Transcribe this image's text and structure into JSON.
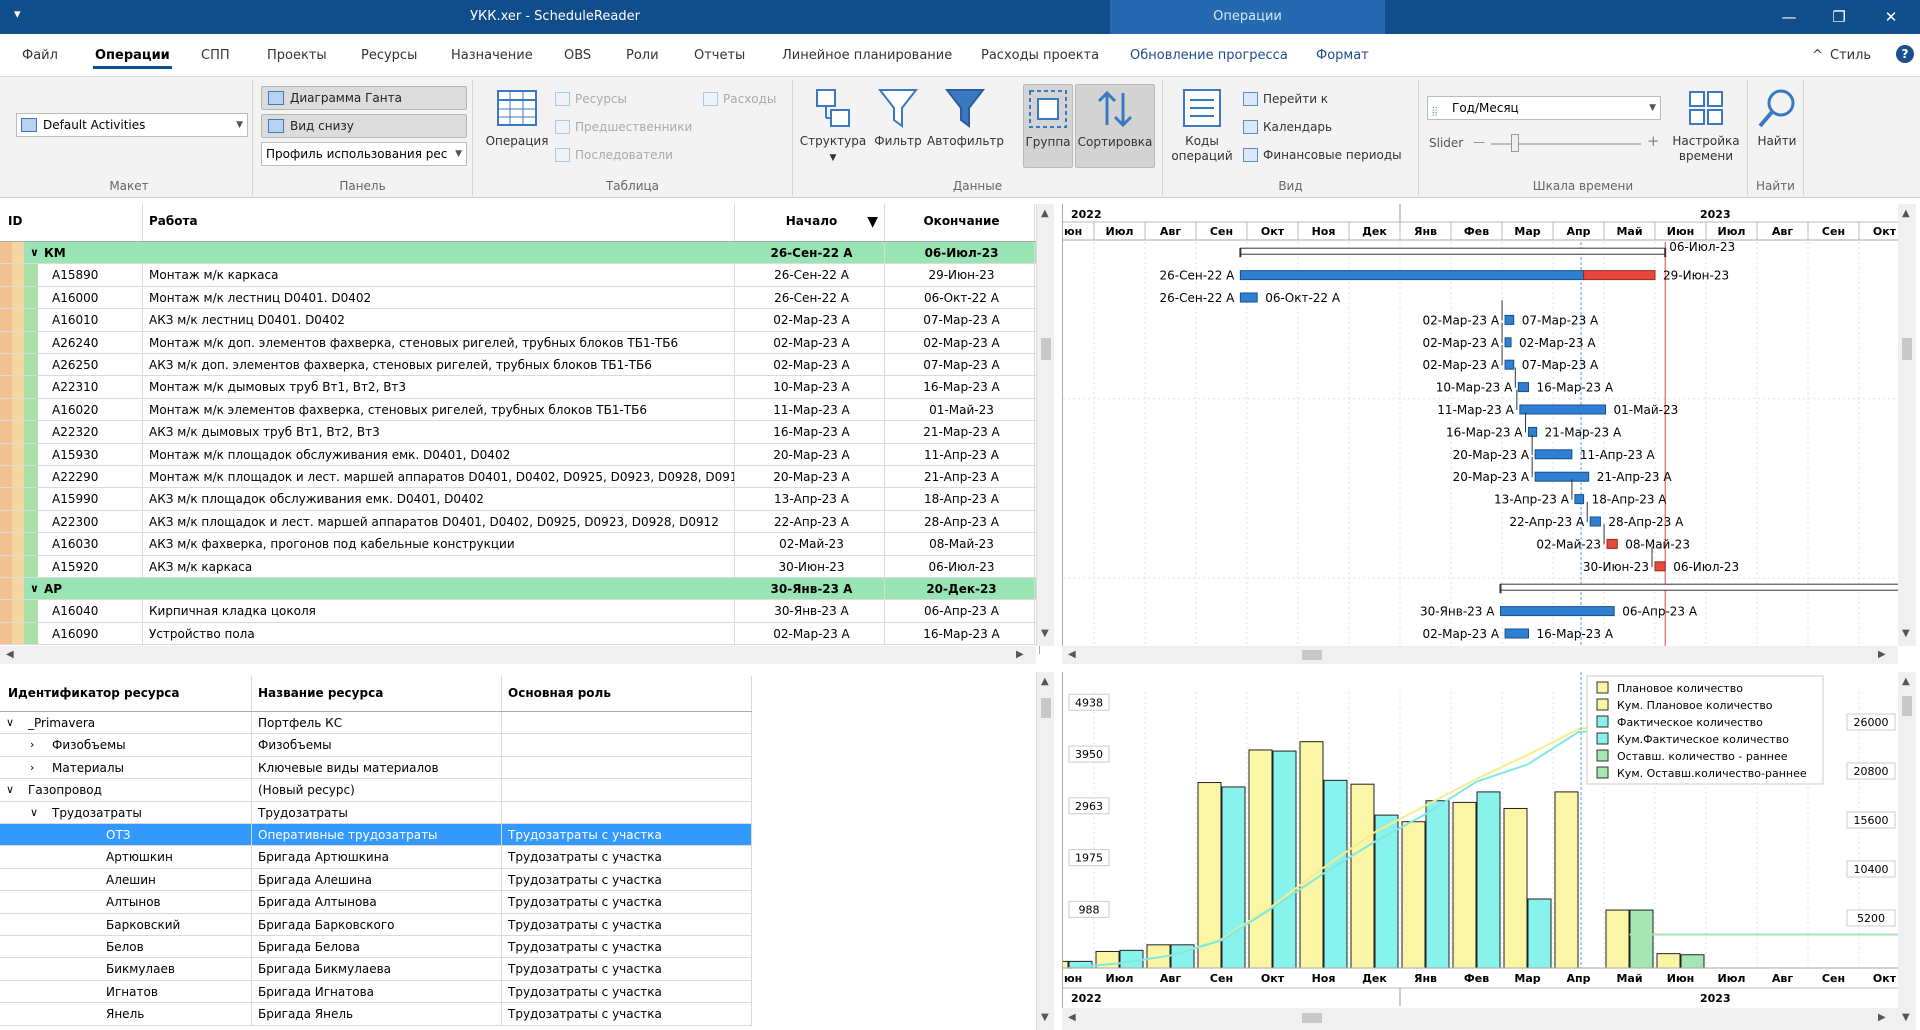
{
  "titlebar": {
    "title": "УКК.xer - ScheduleReader",
    "context_tab": "Операции",
    "quick_access": "▾",
    "minimize": "—",
    "restore": "❐",
    "close": "✕"
  },
  "menu": {
    "items": [
      "Файл",
      "Операции",
      "СПП",
      "Проекты",
      "Ресурсы",
      "Назначение",
      "OBS",
      "Роли",
      "Отчеты",
      "Линейное планирование",
      "Расходы проекта",
      "Обновление прогресса",
      "Формат"
    ],
    "active_index": 1,
    "style_label": "Стиль",
    "collapse": "^",
    "help": "?"
  },
  "ribbon": {
    "layout": {
      "combo": "Default Activities",
      "label": "Макет"
    },
    "panel": {
      "gantt": "Диаграмма Ганта",
      "bottom_view": "Вид снизу",
      "profile_combo": "Профиль использования рес",
      "label": "Панель"
    },
    "table": {
      "operation": "Операция",
      "resources": "Ресурсы",
      "predecessors": "Предшественники",
      "successors": "Последователи",
      "expenses": "Расходы",
      "label": "Таблица"
    },
    "data": {
      "structure": "Структура",
      "filter": "Фильтр",
      "autofilter": "Автофильтр",
      "group": "Группа",
      "sort": "Сортировка",
      "label": "Данные"
    },
    "view": {
      "activity_codes_1": "Коды",
      "activity_codes_2": "операций",
      "goto": "Перейти к",
      "calendar": "Календарь",
      "fin_periods": "Финансовые периоды",
      "label": "Вид"
    },
    "timescale": {
      "combo": "Год/Месяц",
      "slider_label": "Slider",
      "minus": "—",
      "plus": "+",
      "settings_1": "Настройка",
      "settings_2": "времени",
      "label": "Шкала времени"
    },
    "find": {
      "find": "Найти",
      "label": "Найти"
    }
  },
  "activities": {
    "headers": {
      "id": "ID",
      "name": "Работа",
      "start": "Начало",
      "finish": "Окончание",
      "sort_arrow": "▼"
    },
    "rows": [
      {
        "type": "group",
        "id": "КМ",
        "name": "",
        "start": "26-Сен-22 A",
        "finish": "06-Июл-23"
      },
      {
        "type": "task",
        "id": "A15890",
        "name": "Монтаж м/к каркаса",
        "start": "26-Сен-22 A",
        "finish": "29-Июн-23"
      },
      {
        "type": "task",
        "id": "A16000",
        "name": "Монтаж м/к лестниц D0401. D0402",
        "start": "26-Сен-22 A",
        "finish": "06-Окт-22 A"
      },
      {
        "type": "task",
        "id": "A16010",
        "name": "АКЗ м/к лестниц D0401. D0402",
        "start": "02-Мар-23 A",
        "finish": "07-Мар-23 A"
      },
      {
        "type": "task",
        "id": "A26240",
        "name": "Монтаж м/к доп. элементов фахверка, стеновых ригелей, трубных блоков ТБ1-ТБ6",
        "start": "02-Мар-23 A",
        "finish": "02-Мар-23 A"
      },
      {
        "type": "task",
        "id": "A26250",
        "name": "АКЗ м/к доп. элементов фахверка, стеновых ригелей, трубных блоков ТБ1-ТБ6",
        "start": "02-Мар-23 A",
        "finish": "07-Мар-23 A"
      },
      {
        "type": "task",
        "id": "A22310",
        "name": "Монтаж м/к дымовых труб  Вт1, Вт2, Вт3",
        "start": "10-Мар-23 A",
        "finish": "16-Мар-23 A"
      },
      {
        "type": "task",
        "id": "A16020",
        "name": "Монтаж м/к элементов фахверка, стеновых ригелей, трубных блоков ТБ1-ТБ6",
        "start": "11-Мар-23 A",
        "finish": "01-Май-23"
      },
      {
        "type": "task",
        "id": "A22320",
        "name": "АКЗ м/к дымовых труб  Вт1, Вт2, Вт3",
        "start": "16-Мар-23 A",
        "finish": "21-Мар-23 A"
      },
      {
        "type": "task",
        "id": "A15930",
        "name": "Монтаж м/к площадок обслуживания емк. D0401, D0402",
        "start": "20-Мар-23 A",
        "finish": "11-Апр-23 A"
      },
      {
        "type": "task",
        "id": "A22290",
        "name": "Монтаж м/к площадок и лест. маршей аппаратов D0401, D0402, D0925, D0923, D0928, D0912",
        "start": "20-Мар-23 A",
        "finish": "21-Апр-23 A"
      },
      {
        "type": "task",
        "id": "A15990",
        "name": "АКЗ м/к площадок обслуживания емк. D0401, D0402",
        "start": "13-Апр-23 A",
        "finish": "18-Апр-23 A"
      },
      {
        "type": "task",
        "id": "A22300",
        "name": "АКЗ м/к площадок и лест. маршей аппаратов D0401, D0402, D0925, D0923, D0928, D0912",
        "start": "22-Апр-23 A",
        "finish": "28-Апр-23 A"
      },
      {
        "type": "task",
        "id": "A16030",
        "name": "АКЗ м/к фахверка, прогонов под кабельные конструкции",
        "start": "02-Май-23",
        "finish": "08-Май-23"
      },
      {
        "type": "task",
        "id": "A15920",
        "name": "АКЗ м/к каркаса",
        "start": "30-Июн-23",
        "finish": "06-Июл-23"
      },
      {
        "type": "group",
        "id": "АР",
        "name": "",
        "start": "30-Янв-23 A",
        "finish": "20-Дек-23"
      },
      {
        "type": "task",
        "id": "A16040",
        "name": "Кирпичная кладка цоколя",
        "start": "30-Янв-23 A",
        "finish": "06-Апр-23 A"
      },
      {
        "type": "task",
        "id": "A16090",
        "name": "Устройство пола",
        "start": "02-Мар-23 A",
        "finish": "16-Мар-23 A"
      }
    ]
  },
  "timeline": {
    "year_left": "2022",
    "year_right": "2023",
    "months": [
      "Июн",
      "Июл",
      "Авг",
      "Сен",
      "Окт",
      "Ноя",
      "Дек",
      "Янв",
      "Фев",
      "Мар",
      "Апр",
      "Май",
      "Июн",
      "Июл",
      "Авг",
      "Сен",
      "Окт"
    ]
  },
  "gantt": {
    "bars": [
      {
        "row": 0,
        "type": "summary",
        "start": 3.87,
        "end": 12.2
      },
      {
        "row": 1,
        "type": "split",
        "start": 3.87,
        "split": 10.6,
        "end": 12.0,
        "left": "26-Сен-22 A",
        "right": "29-Июн-23"
      },
      {
        "row": 2,
        "type": "actual",
        "start": 3.87,
        "end": 4.2,
        "left": "26-Сен-22 A",
        "right": "06-Окт-22 A"
      },
      {
        "row": 3,
        "type": "actual",
        "start": 9.06,
        "end": 9.23,
        "left": "02-Мар-23 A",
        "right": "07-Мар-23 A"
      },
      {
        "row": 4,
        "type": "actual",
        "start": 9.06,
        "end": 9.1,
        "left": "02-Мар-23 A",
        "right": "02-Мар-23 A"
      },
      {
        "row": 5,
        "type": "actual",
        "start": 9.06,
        "end": 9.23,
        "left": "02-Мар-23 A",
        "right": "07-Мар-23 A"
      },
      {
        "row": 6,
        "type": "actual",
        "start": 9.32,
        "end": 9.52,
        "left": "10-Мар-23 A",
        "right": "16-Мар-23 A"
      },
      {
        "row": 7,
        "type": "actual",
        "start": 9.35,
        "end": 11.03,
        "left": "11-Мар-23 A",
        "right": "01-Май-23"
      },
      {
        "row": 8,
        "type": "actual",
        "start": 9.52,
        "end": 9.68,
        "left": "16-Мар-23 A",
        "right": "21-Мар-23 A"
      },
      {
        "row": 9,
        "type": "actual",
        "start": 9.65,
        "end": 10.37,
        "left": "20-Мар-23 A",
        "right": "11-Апр-23 A"
      },
      {
        "row": 10,
        "type": "actual",
        "start": 9.65,
        "end": 10.7,
        "left": "20-Мар-23 A",
        "right": "21-Апр-23 A"
      },
      {
        "row": 11,
        "type": "actual",
        "start": 10.43,
        "end": 10.6,
        "left": "13-Апр-23 A",
        "right": "18-Апр-23 A"
      },
      {
        "row": 12,
        "type": "actual",
        "start": 10.73,
        "end": 10.93,
        "left": "22-Апр-23 A",
        "right": "28-Апр-23 A"
      },
      {
        "row": 13,
        "type": "plan",
        "start": 11.06,
        "end": 11.26,
        "left": "02-Май-23",
        "right": "08-Май-23"
      },
      {
        "row": 14,
        "type": "plan",
        "start": 12.0,
        "end": 12.2,
        "left": "30-Июн-23",
        "right": "06-Июл-23"
      },
      {
        "row": 15,
        "type": "summary",
        "start": 8.97,
        "end": 17.5
      },
      {
        "row": 16,
        "type": "actual",
        "start": 8.97,
        "end": 11.2,
        "left": "30-Янв-23 A",
        "right": "06-Апр-23 A"
      },
      {
        "row": 17,
        "type": "actual",
        "start": 9.06,
        "end": 9.52,
        "left": "02-Мар-23 A",
        "right": "16-Мар-23 A"
      }
    ],
    "summary0_right": "06-Июл-23",
    "data_date_month": 10.55
  },
  "resources": {
    "headers": {
      "id": "Идентификатор ресурса",
      "name": "Название ресурса",
      "role": "Основная роль"
    },
    "rows": [
      {
        "level": 0,
        "toggle": "v",
        "id": "_Primavera",
        "name": "Портфель КС",
        "role": ""
      },
      {
        "level": 1,
        "toggle": ">",
        "id": "Физобъемы",
        "name": "Физобъемы",
        "role": ""
      },
      {
        "level": 1,
        "toggle": ">",
        "id": "Материалы",
        "name": "Ключевые виды материалов",
        "role": ""
      },
      {
        "level": 0,
        "toggle": "v",
        "id": "Газопровод",
        "name": "(Новый ресурс)",
        "role": ""
      },
      {
        "level": 1,
        "toggle": "v",
        "id": "Трудозатраты",
        "name": "Трудозатраты",
        "role": ""
      },
      {
        "level": 2,
        "toggle": "",
        "id": "ОТЗ",
        "name": "Оперативные трудозатраты",
        "role": "Трудозатраты с участка",
        "selected": true
      },
      {
        "level": 2,
        "toggle": "",
        "id": "Артюшкин",
        "name": "Бригада Артюшкина",
        "role": "Трудозатраты с участка"
      },
      {
        "level": 2,
        "toggle": "",
        "id": "Алешин",
        "name": "Бригада Алешина",
        "role": "Трудозатраты с участка"
      },
      {
        "level": 2,
        "toggle": "",
        "id": "Алтынов",
        "name": "Бригада Алтынова",
        "role": "Трудозатраты с участка"
      },
      {
        "level": 2,
        "toggle": "",
        "id": "Барковский",
        "name": "Бригада Барковского",
        "role": "Трудозатраты с участка"
      },
      {
        "level": 2,
        "toggle": "",
        "id": "Белов",
        "name": "Бригада Белова",
        "role": "Трудозатраты с участка"
      },
      {
        "level": 2,
        "toggle": "",
        "id": "Бикмулаев",
        "name": "Бригада Бикмулаева",
        "role": "Трудозатраты с участка"
      },
      {
        "level": 2,
        "toggle": "",
        "id": "Игнатов",
        "name": "Бригада Игнатова",
        "role": "Трудозатраты с участка"
      },
      {
        "level": 2,
        "toggle": "",
        "id": "Янель",
        "name": "Бригада Янель",
        "role": "Трудозатраты с участка"
      }
    ]
  },
  "chart_data": {
    "type": "bar",
    "title": "",
    "categories": [
      "Июн",
      "Июл",
      "Авг",
      "Сен",
      "Окт",
      "Ноя",
      "Дек",
      "Янв",
      "Фев",
      "Мар",
      "Апр",
      "Май",
      "Июн"
    ],
    "series": [
      {
        "name": "Плановое количество",
        "color": "#fbf5a6",
        "values": [
          120,
          300,
          420,
          3360,
          3950,
          4100,
          3330,
          2650,
          3000,
          2890,
          3190,
          1050,
          260
        ]
      },
      {
        "name": "Фактическое количество",
        "color": "#88f2ec",
        "values": [
          120,
          320,
          420,
          3280,
          3930,
          3400,
          2770,
          3030,
          3190,
          1250,
          0,
          0,
          0
        ]
      },
      {
        "name": "Оставш. количество - раннее",
        "color": "#a6e6b2",
        "values": [
          0,
          0,
          0,
          0,
          0,
          0,
          0,
          0,
          0,
          0,
          0,
          1050,
          240
        ]
      }
    ],
    "legend_entries": [
      "Плановое количество",
      "Кум. Плановое количество",
      "Фактическое количество",
      "Кум.Фактическое количество",
      "Оставш. количество - раннее",
      "Кум. Оставш.количество-раннее"
    ],
    "legend_colors": [
      "#fbf5a6",
      "#fbf5a6",
      "#88f2ec",
      "#88f2ec",
      "#a6e6b2",
      "#a6e6b2"
    ],
    "cumulative_plan": [
      0,
      500,
      1300,
      3000,
      6500,
      10500,
      14200,
      17000,
      19800,
      22300,
      25000,
      26000,
      26300
    ],
    "cumulative_actual": [
      0,
      500,
      1300,
      2900,
      6300,
      9900,
      13200,
      16100,
      19500,
      21300,
      24700,
      25000,
      25000
    ],
    "y_left_ticks": [
      "4938",
      "3950",
      "2963",
      "1975",
      "988"
    ],
    "y_right_ticks": [
      "26000",
      "20800",
      "15600",
      "10400",
      "5200"
    ],
    "ylim": [
      0,
      5000
    ],
    "y2lim": [
      0,
      26000
    ],
    "year_left": "2022",
    "year_right": "2023",
    "legend_position": "top-right"
  }
}
